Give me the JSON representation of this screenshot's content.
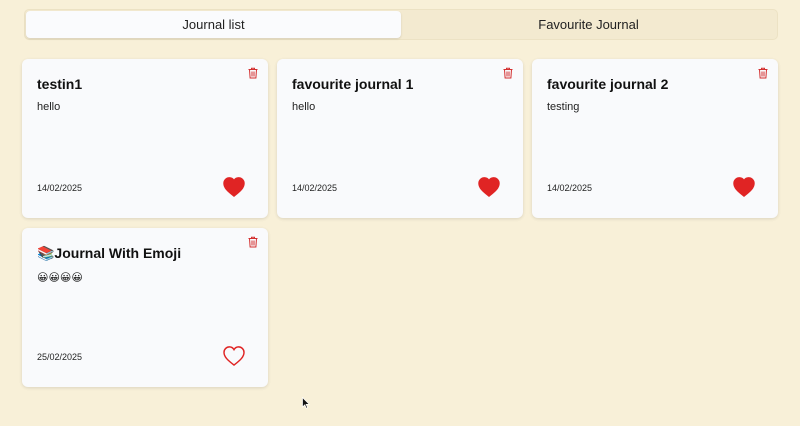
{
  "tabs": [
    {
      "label": "Journal list",
      "active": true
    },
    {
      "label": "Favourite Journal",
      "active": false
    }
  ],
  "journals": [
    {
      "title": "testin1",
      "body": "hello",
      "date": "14/02/2025",
      "favourite": true
    },
    {
      "title": "favourite journal 1",
      "body": "hello",
      "date": "14/02/2025",
      "favourite": true
    },
    {
      "title": "favourite journal 2",
      "body": "testing",
      "date": "14/02/2025",
      "favourite": true
    },
    {
      "title": "📚Journal With Emoji",
      "body": "😀😀😀😀",
      "date": "25/02/2025",
      "favourite": false
    }
  ],
  "icons": {
    "delete": "trash-icon",
    "favourite": "heart-icon"
  },
  "colors": {
    "background": "#f8f0d8",
    "heart": "#e02424",
    "trash": "#d32f2f"
  }
}
